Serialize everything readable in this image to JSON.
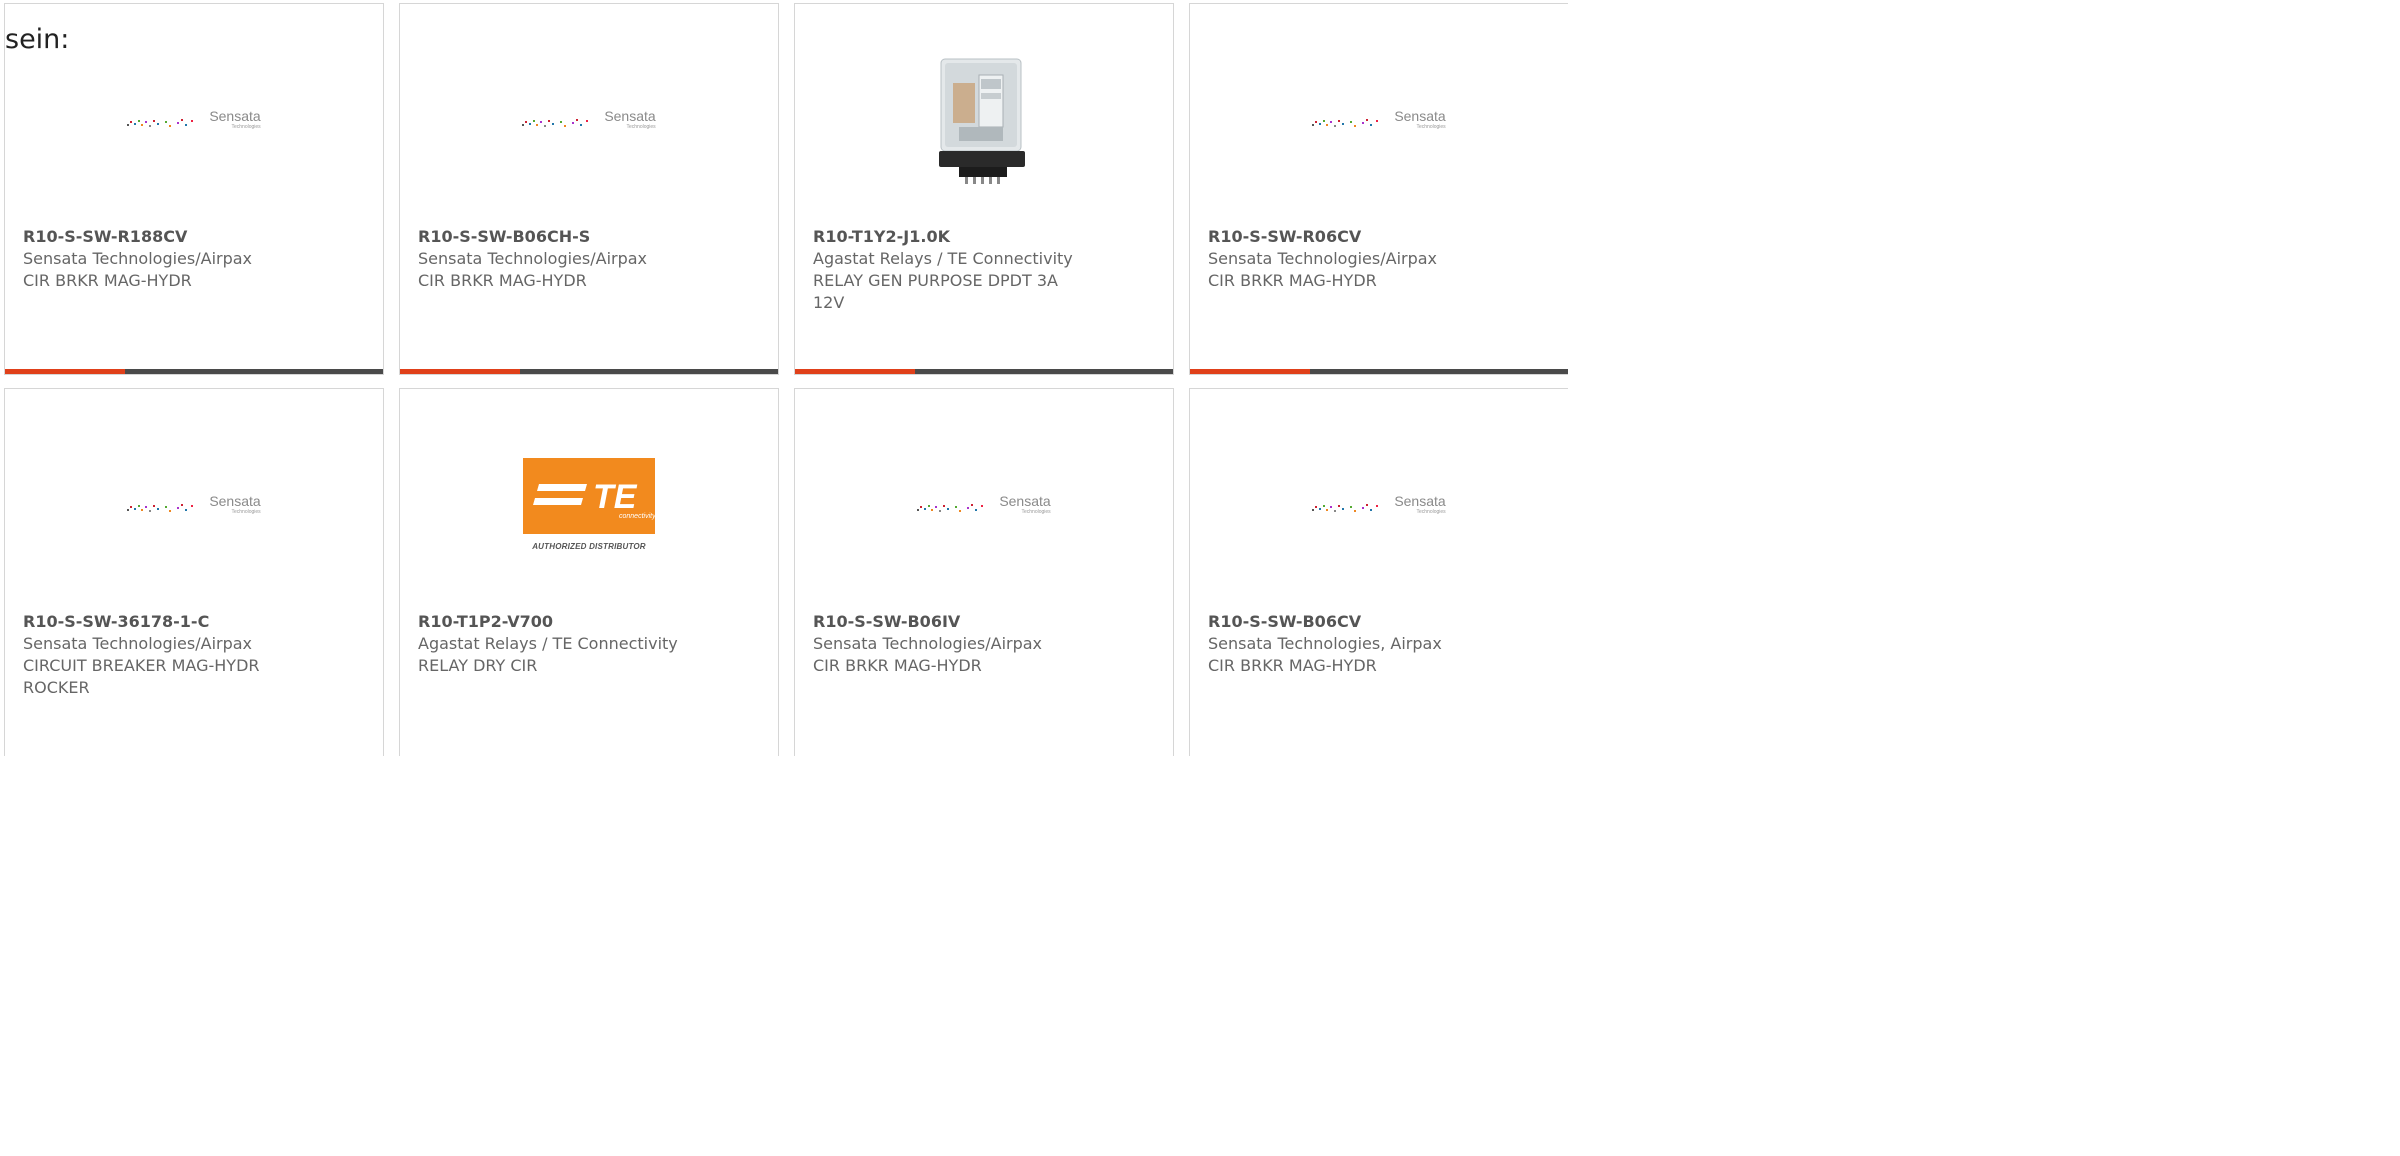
{
  "prefix_text": "sein:",
  "colors": {
    "accent_bar": "#e0401a",
    "bar": "#4a4a4a",
    "te_orange": "#f28a1e"
  },
  "cards": [
    {
      "part_number": "R10-S-SW-R188CV",
      "manufacturer": "Sensata Technologies/Airpax",
      "description": "CIR BRKR MAG-HYDR",
      "image": "sensata-logo",
      "logo_text": "Sensata",
      "logo_subtext": "Technologies"
    },
    {
      "part_number": "R10-S-SW-B06CH-S",
      "manufacturer": "Sensata Technologies/Airpax",
      "description": "CIR BRKR MAG-HYDR",
      "image": "sensata-logo",
      "logo_text": "Sensata",
      "logo_subtext": "Technologies"
    },
    {
      "part_number": "R10-T1Y2-J1.0K",
      "manufacturer": "Agastat Relays / TE Connectivity",
      "description": "RELAY GEN PURPOSE DPDT 3A 12V",
      "image": "relay-photo"
    },
    {
      "part_number": "R10-S-SW-R06CV",
      "manufacturer": "Sensata Technologies/Airpax",
      "description": "CIR BRKR MAG-HYDR",
      "image": "sensata-logo",
      "logo_text": "Sensata",
      "logo_subtext": "Technologies"
    },
    {
      "part_number": "R10-S-SW-36178-1-C",
      "manufacturer": "Sensata Technologies/Airpax",
      "description": "CIRCUIT BREAKER MAG-HYDR ROCKER",
      "image": "sensata-logo",
      "logo_text": "Sensata",
      "logo_subtext": "Technologies"
    },
    {
      "part_number": "R10-T1P2-V700",
      "manufacturer": "Agastat Relays / TE Connectivity",
      "description": "RELAY DRY CIR",
      "image": "te-logo",
      "logo_text": "TE",
      "logo_subtext": "connectivity",
      "logo_caption": "AUTHORIZED DISTRIBUTOR"
    },
    {
      "part_number": "R10-S-SW-B06IV",
      "manufacturer": "Sensata Technologies/Airpax",
      "description": "CIR BRKR MAG-HYDR",
      "image": "sensata-logo",
      "logo_text": "Sensata",
      "logo_subtext": "Technologies"
    },
    {
      "part_number": "R10-S-SW-B06CV",
      "manufacturer": "Sensata Technologies, Airpax",
      "description": "CIR BRKR MAG-HYDR",
      "image": "sensata-logo",
      "logo_text": "Sensata",
      "logo_subtext": "Technologies"
    }
  ]
}
